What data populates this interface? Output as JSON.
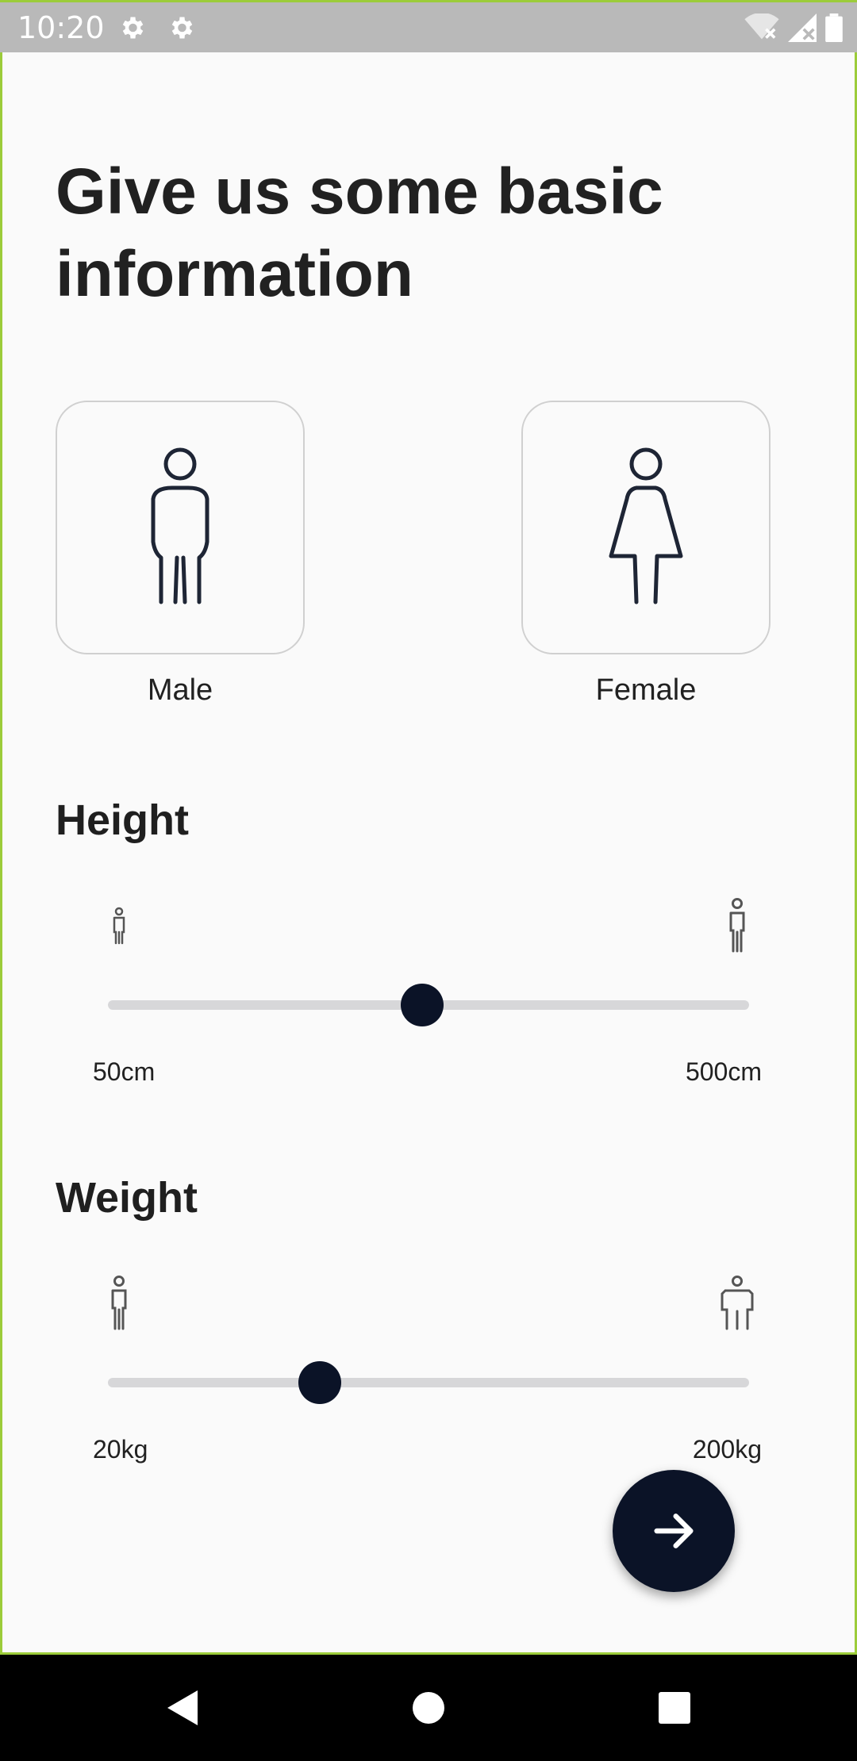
{
  "status_bar": {
    "time": "10:20",
    "icons": [
      "gear-icon",
      "gear-icon",
      "wifi-off-icon",
      "signal-off-icon",
      "battery-icon"
    ]
  },
  "title": "Give us some basic information",
  "gender": {
    "options": [
      {
        "label": "Male",
        "icon": "male-figure-icon"
      },
      {
        "label": "Female",
        "icon": "female-figure-icon"
      }
    ]
  },
  "height": {
    "title": "Height",
    "min_label": "50cm",
    "max_label": "500cm",
    "value_fraction": 0.49
  },
  "weight": {
    "title": "Weight",
    "min_label": "20kg",
    "max_label": "200kg",
    "value_fraction": 0.33
  },
  "next_button": {
    "icon": "arrow-right-icon"
  },
  "nav": {
    "icons": [
      "back-icon",
      "home-icon",
      "recents-icon"
    ]
  },
  "colors": {
    "accent": "#0b1327",
    "track": "#d7d7d9",
    "status_bar": "#b9b9b9",
    "frame_border": "#9ccc3a"
  }
}
